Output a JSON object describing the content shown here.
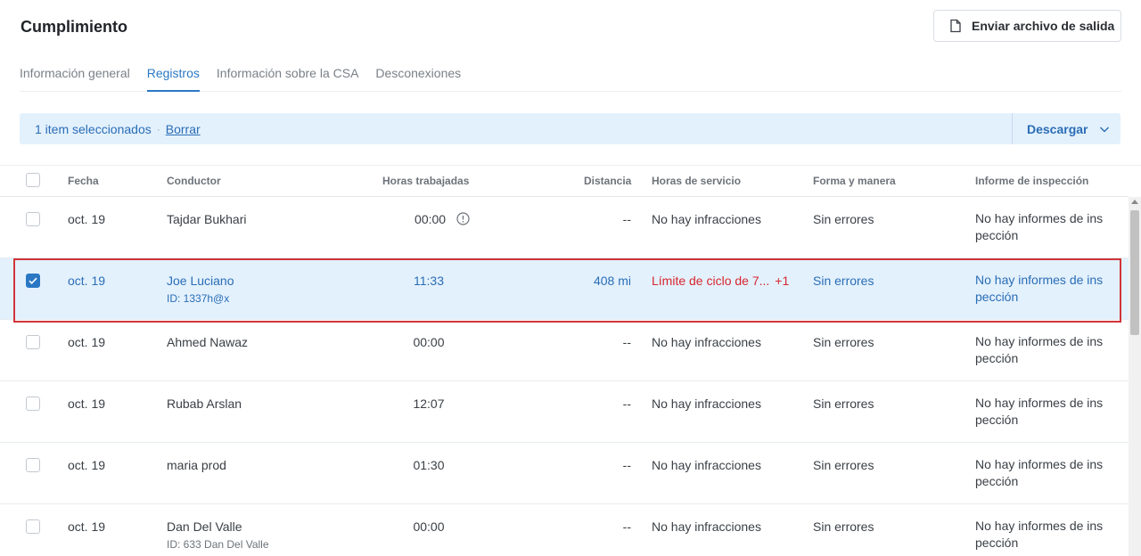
{
  "header": {
    "title": "Cumplimiento",
    "send_button_label": "Enviar archivo de salida"
  },
  "tabs": [
    {
      "label": "Información general",
      "active": false
    },
    {
      "label": "Registros",
      "active": true
    },
    {
      "label": "Información sobre la CSA",
      "active": false
    },
    {
      "label": "Desconexiones",
      "active": false
    }
  ],
  "selection_bar": {
    "text": "1 item seleccionados",
    "separator": "·",
    "clear_label": "Borrar",
    "download_label": "Descargar"
  },
  "columns": {
    "date": "Fecha",
    "driver": "Conductor",
    "hours_worked": "Horas trabajadas",
    "distance": "Distancia",
    "hos": "Horas de servicio",
    "form_manner": "Forma y manera",
    "inspection": "Informe de inspección"
  },
  "rows": [
    {
      "date": "oct. 19",
      "driver": "Tajdar Bukhari",
      "driver_id": "",
      "hours": "00:00",
      "distance": "--",
      "hos": "No hay infracciones",
      "hos_extra": "",
      "form": "Sin errores",
      "inspection": "No hay informes de ins pección",
      "selected": false
    },
    {
      "date": "oct. 19",
      "driver": "Joe Luciano",
      "driver_id": "ID: 1337h@x",
      "hours": "11:33",
      "distance": "408 mi",
      "hos": "Límite de ciclo de 7...",
      "hos_extra": "+1",
      "form": "Sin errores",
      "inspection": "No hay informes de ins pección",
      "selected": true
    },
    {
      "date": "oct. 19",
      "driver": "Ahmed Nawaz",
      "driver_id": "",
      "hours": "00:00",
      "distance": "--",
      "hos": "No hay infracciones",
      "hos_extra": "",
      "form": "Sin errores",
      "inspection": "No hay informes de ins pección",
      "selected": false
    },
    {
      "date": "oct. 19",
      "driver": "Rubab Arslan",
      "driver_id": "",
      "hours": "12:07",
      "distance": "--",
      "hos": "No hay infracciones",
      "hos_extra": "",
      "form": "Sin errores",
      "inspection": "No hay informes de ins pección",
      "selected": false
    },
    {
      "date": "oct. 19",
      "driver": "maria prod",
      "driver_id": "",
      "hours": "01:30",
      "distance": "--",
      "hos": "No hay infracciones",
      "hos_extra": "",
      "form": "Sin errores",
      "inspection": "No hay informes de ins pección",
      "selected": false
    },
    {
      "date": "oct. 19",
      "driver": "Dan Del Valle",
      "driver_id": "ID: 633 Dan Del Valle",
      "hours": "00:00",
      "distance": "--",
      "hos": "No hay infracciones",
      "hos_extra": "",
      "form": "Sin errores",
      "inspection": "No hay informes de ins pección",
      "selected": false
    }
  ],
  "colors": {
    "accent": "#2a78c4",
    "selected_row": "#e3f1fd",
    "violation": "#d8262e",
    "highlight_border": "#d0343a"
  }
}
